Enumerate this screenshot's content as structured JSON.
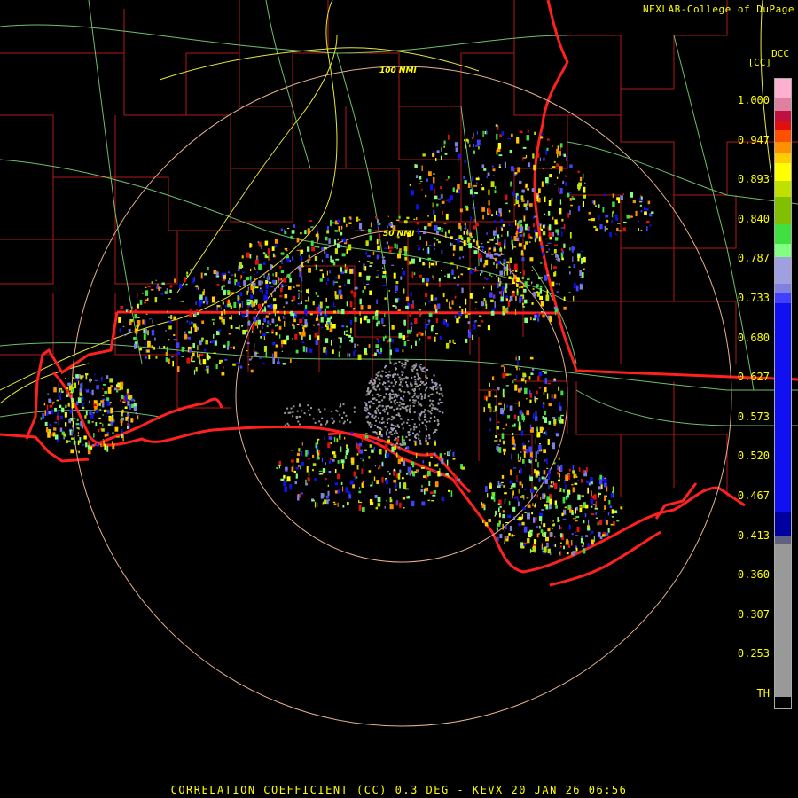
{
  "header": {
    "credit": "NEXLAB-College of DuPage",
    "product_code": "DCC",
    "unit": "[CC]"
  },
  "map": {
    "range_rings": [
      "100 NMI",
      "50 NMI"
    ],
    "colors": {
      "background": "#000000",
      "county_lines": "#b01818",
      "state_lines": "#ff2020",
      "highways": "#80e080",
      "interstates": "#ffff40",
      "range_rings": "#e8b090"
    }
  },
  "legend": {
    "ticks": [
      "1.000",
      "0.947",
      "0.893",
      "0.840",
      "0.787",
      "0.733",
      "0.680",
      "0.627",
      "0.573",
      "0.520",
      "0.467",
      "0.413",
      "0.360",
      "0.307",
      "0.253",
      "TH"
    ],
    "segments": [
      {
        "color": "#ffb0d0",
        "from": 1.0,
        "to": 0.975
      },
      {
        "color": "#e080a0",
        "from": 0.975,
        "to": 0.96
      },
      {
        "color": "#c01040",
        "from": 0.96,
        "to": 0.947
      },
      {
        "color": "#e01010",
        "from": 0.947,
        "to": 0.935
      },
      {
        "color": "#ff5000",
        "from": 0.935,
        "to": 0.92
      },
      {
        "color": "#ff9000",
        "from": 0.92,
        "to": 0.905
      },
      {
        "color": "#ffcc00",
        "from": 0.905,
        "to": 0.893
      },
      {
        "color": "#ffff00",
        "from": 0.893,
        "to": 0.87
      },
      {
        "color": "#c0e000",
        "from": 0.87,
        "to": 0.85
      },
      {
        "color": "#80c000",
        "from": 0.85,
        "to": 0.815
      },
      {
        "color": "#40e040",
        "from": 0.815,
        "to": 0.79
      },
      {
        "color": "#80ff80",
        "from": 0.79,
        "to": 0.773
      },
      {
        "color": "#a0a0e0",
        "from": 0.773,
        "to": 0.74
      },
      {
        "color": "#8080e0",
        "from": 0.74,
        "to": 0.728
      },
      {
        "color": "#4040ff",
        "from": 0.728,
        "to": 0.715
      },
      {
        "color": "#1010f0",
        "from": 0.715,
        "to": 0.45
      },
      {
        "color": "#0000a0",
        "from": 0.45,
        "to": 0.42
      },
      {
        "color": "#606080",
        "from": 0.42,
        "to": 0.41
      },
      {
        "color": "#999999",
        "from": 0.41,
        "to": 0.215
      },
      {
        "color": "#000000",
        "from": 0.215,
        "to": 0.2
      }
    ]
  },
  "footer": {
    "status": "CORRELATION COEFFICIENT (CC) 0.3 DEG - KEVX 20 JAN 26 06:56"
  }
}
